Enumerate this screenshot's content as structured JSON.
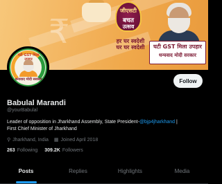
{
  "banner": {
    "badge_line1": "जीएसटी",
    "badge_line2": "बचत",
    "badge_line3": "उत्सव",
    "tagline1": "हर घर स्वदेशी",
    "tagline2": "घर घर स्वदेशी",
    "ribbon_line1": "घटी GST मिला उपहार",
    "ribbon_line2": "धन्यवाद मोदी सरकार"
  },
  "avatar": {
    "top_text": "घटी GST मिला उपहार",
    "bottom_text": "धन्यवाद मोदी सरकार"
  },
  "actions": {
    "follow_label": "Follow"
  },
  "profile": {
    "display_name": "Babulal Marandi",
    "handle": "@yourBabulal",
    "bio_text": "Leader of opposition in Jharkhand Assembly, State President-",
    "bio_mention": "@bjp4jharkhand",
    "bio_suffix": " |",
    "bio_line2": "First Chief Minister of Jharkhand",
    "location": "Jharkhand, India",
    "joined": "Joined April 2018"
  },
  "stats": {
    "following_count": "263",
    "following_label": "Following",
    "followers_count": "309.2K",
    "followers_label": "Followers"
  },
  "tabs": [
    {
      "label": "Posts",
      "active": true
    },
    {
      "label": "Replies",
      "active": false
    },
    {
      "label": "Highlights",
      "active": false
    },
    {
      "label": "Media",
      "active": false
    }
  ],
  "colors": {
    "accent": "#1d9bf0",
    "background": "#000000",
    "muted_text": "#71767b"
  },
  "icons": [
    "location-icon",
    "calendar-icon"
  ]
}
